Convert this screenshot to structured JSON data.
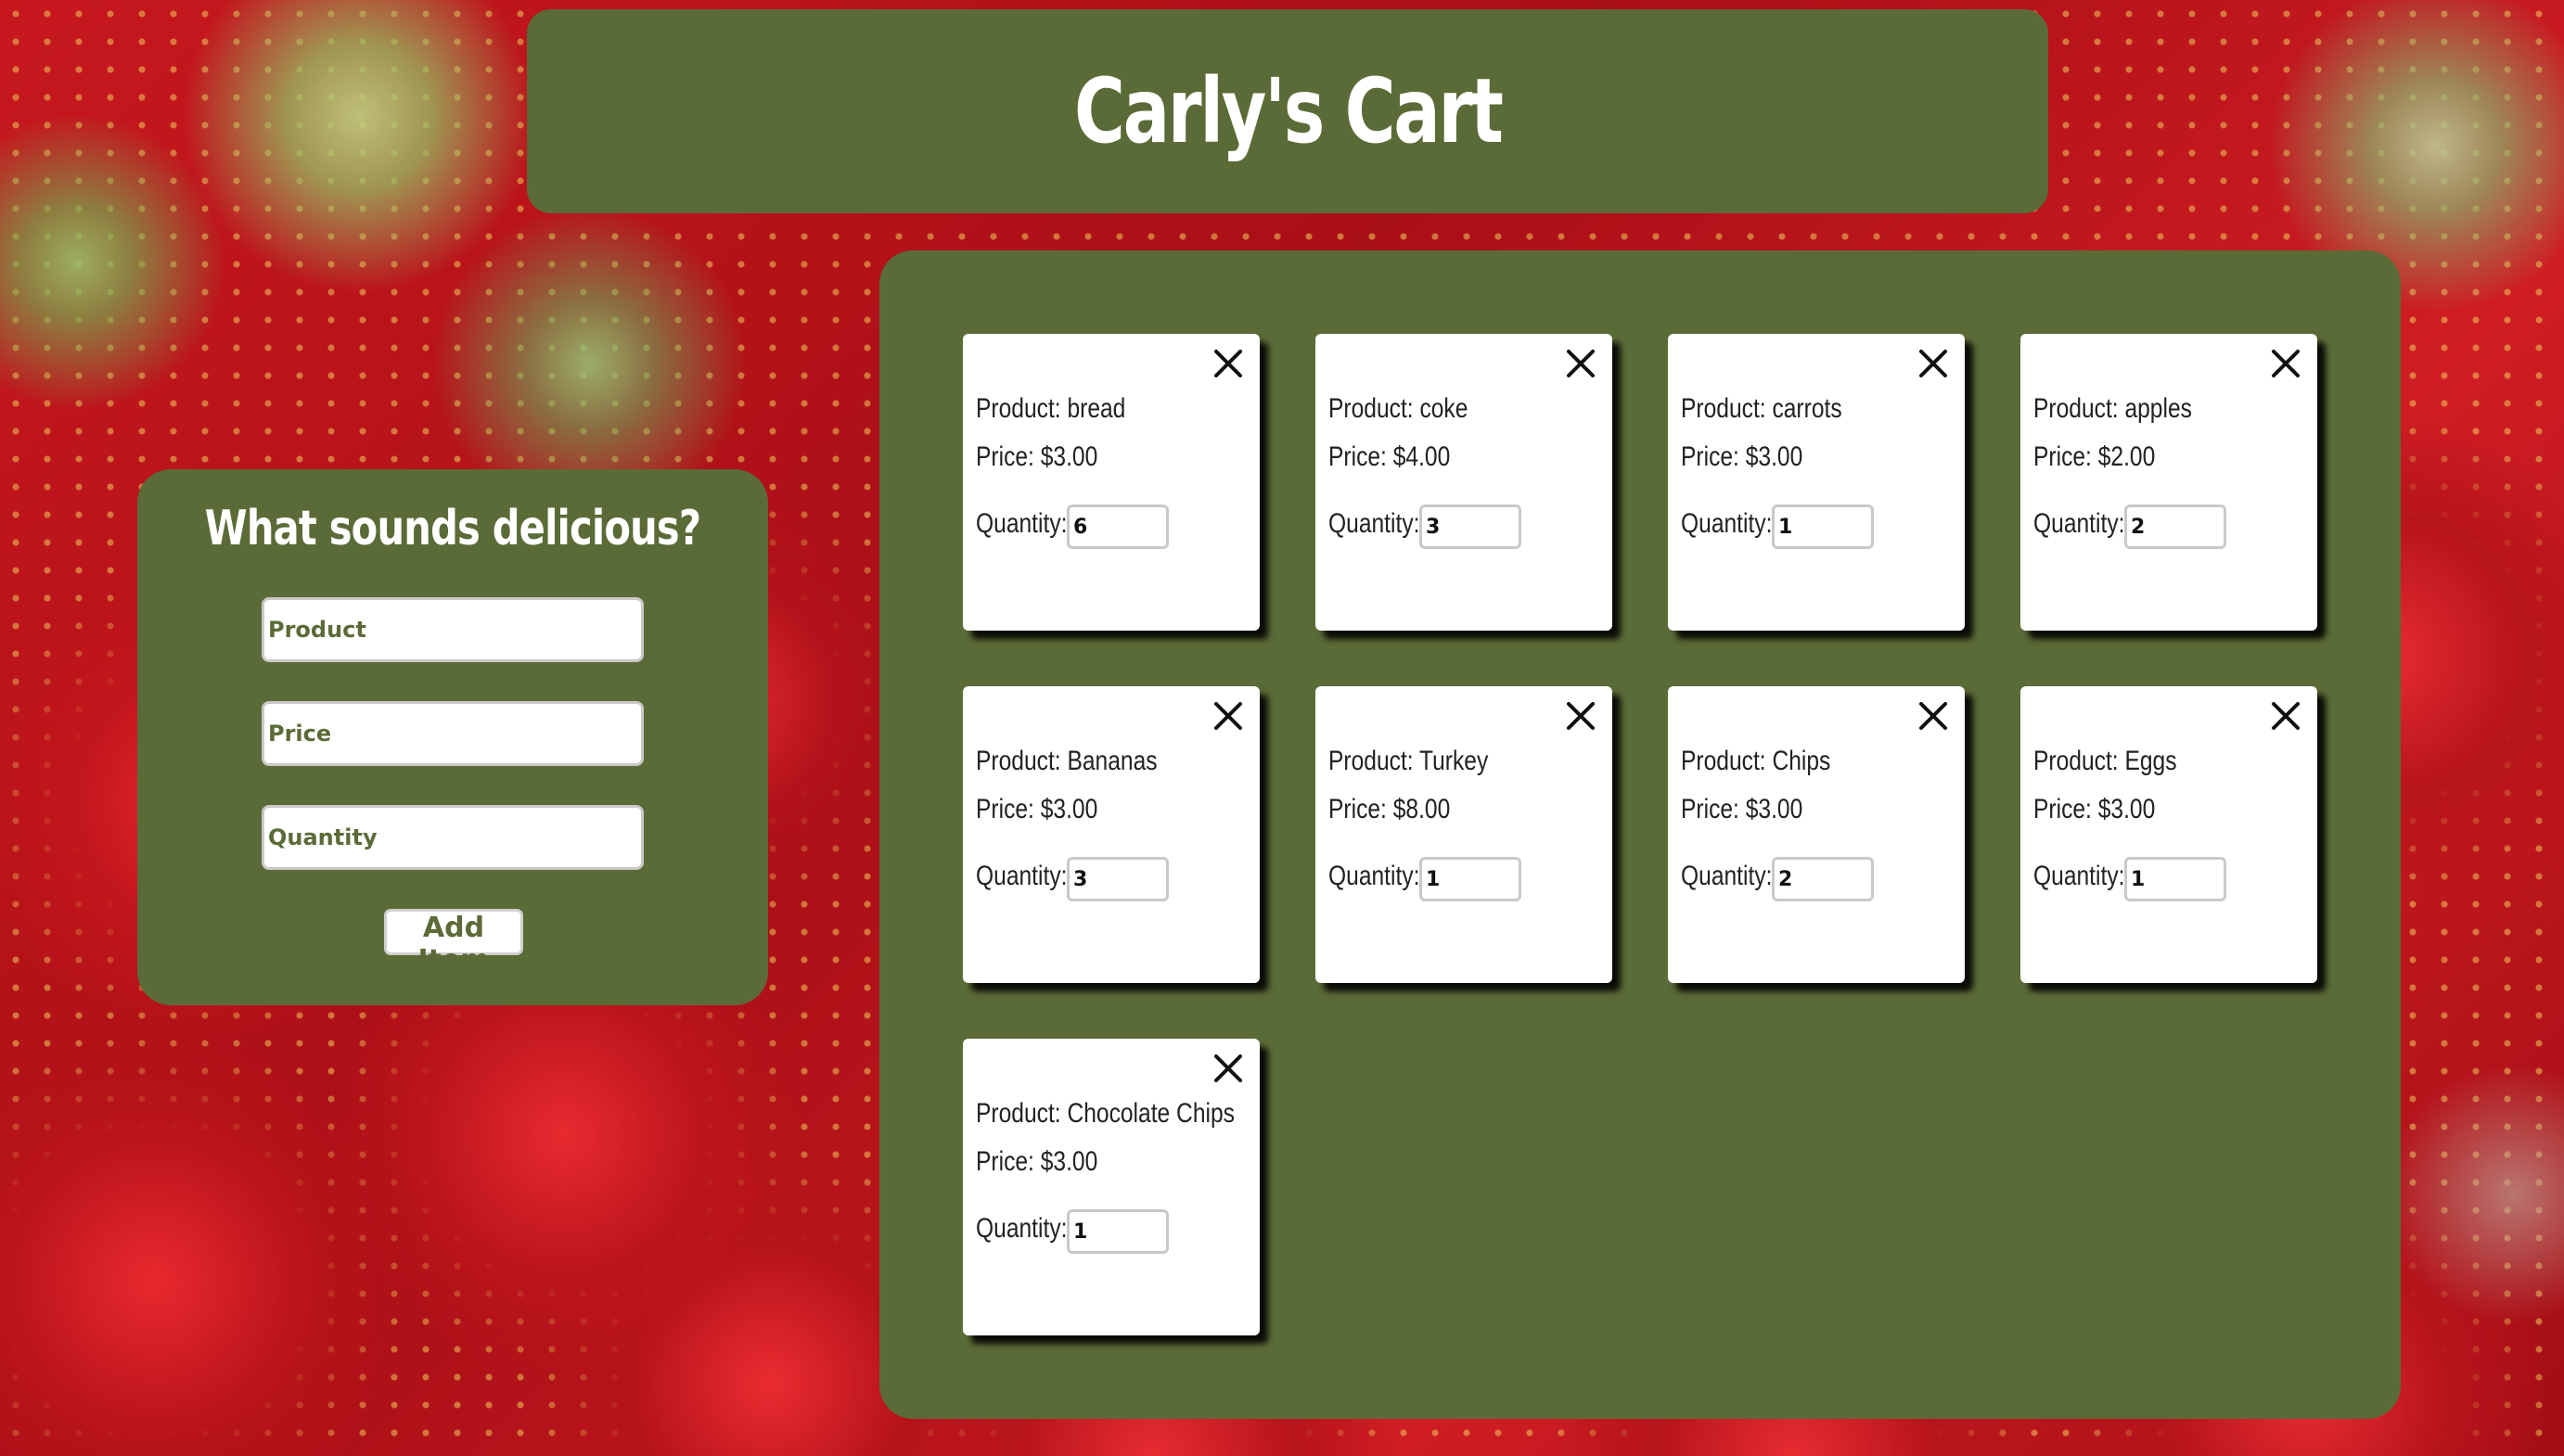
{
  "header": {
    "title": "Carly's Cart"
  },
  "form": {
    "heading": "What sounds delicious?",
    "product_placeholder": "Product",
    "price_placeholder": "Price",
    "quantity_placeholder": "Quantity",
    "add_button_label": "Add Item"
  },
  "cart": {
    "items": [
      {
        "product": "Product: bread",
        "price": "Price: $3.00",
        "quantity_label": "Quantity:",
        "quantity": "6"
      },
      {
        "product": "Product: coke",
        "price": "Price: $4.00",
        "quantity_label": "Quantity:",
        "quantity": "3"
      },
      {
        "product": "Product: carrots",
        "price": "Price: $3.00",
        "quantity_label": "Quantity:",
        "quantity": "1"
      },
      {
        "product": "Product: apples",
        "price": "Price: $2.00",
        "quantity_label": "Quantity:",
        "quantity": "2"
      },
      {
        "product": "Product: Bananas",
        "price": "Price: $3.00",
        "quantity_label": "Quantity:",
        "quantity": "3"
      },
      {
        "product": "Product: Turkey",
        "price": "Price: $8.00",
        "quantity_label": "Quantity:",
        "quantity": "1"
      },
      {
        "product": "Product: Chips",
        "price": "Price: $3.00",
        "quantity_label": "Quantity:",
        "quantity": "2"
      },
      {
        "product": "Product: Eggs",
        "price": "Price: $3.00",
        "quantity_label": "Quantity:",
        "quantity": "1"
      },
      {
        "product": "Product: Chocolate Chips",
        "price": "Price: $3.00",
        "quantity_label": "Quantity:",
        "quantity": "1"
      }
    ],
    "remove_icon": "close-icon"
  },
  "colors": {
    "panel": "#5b6b37",
    "card": "#ffffff",
    "accent_text": "#5b6b37"
  }
}
